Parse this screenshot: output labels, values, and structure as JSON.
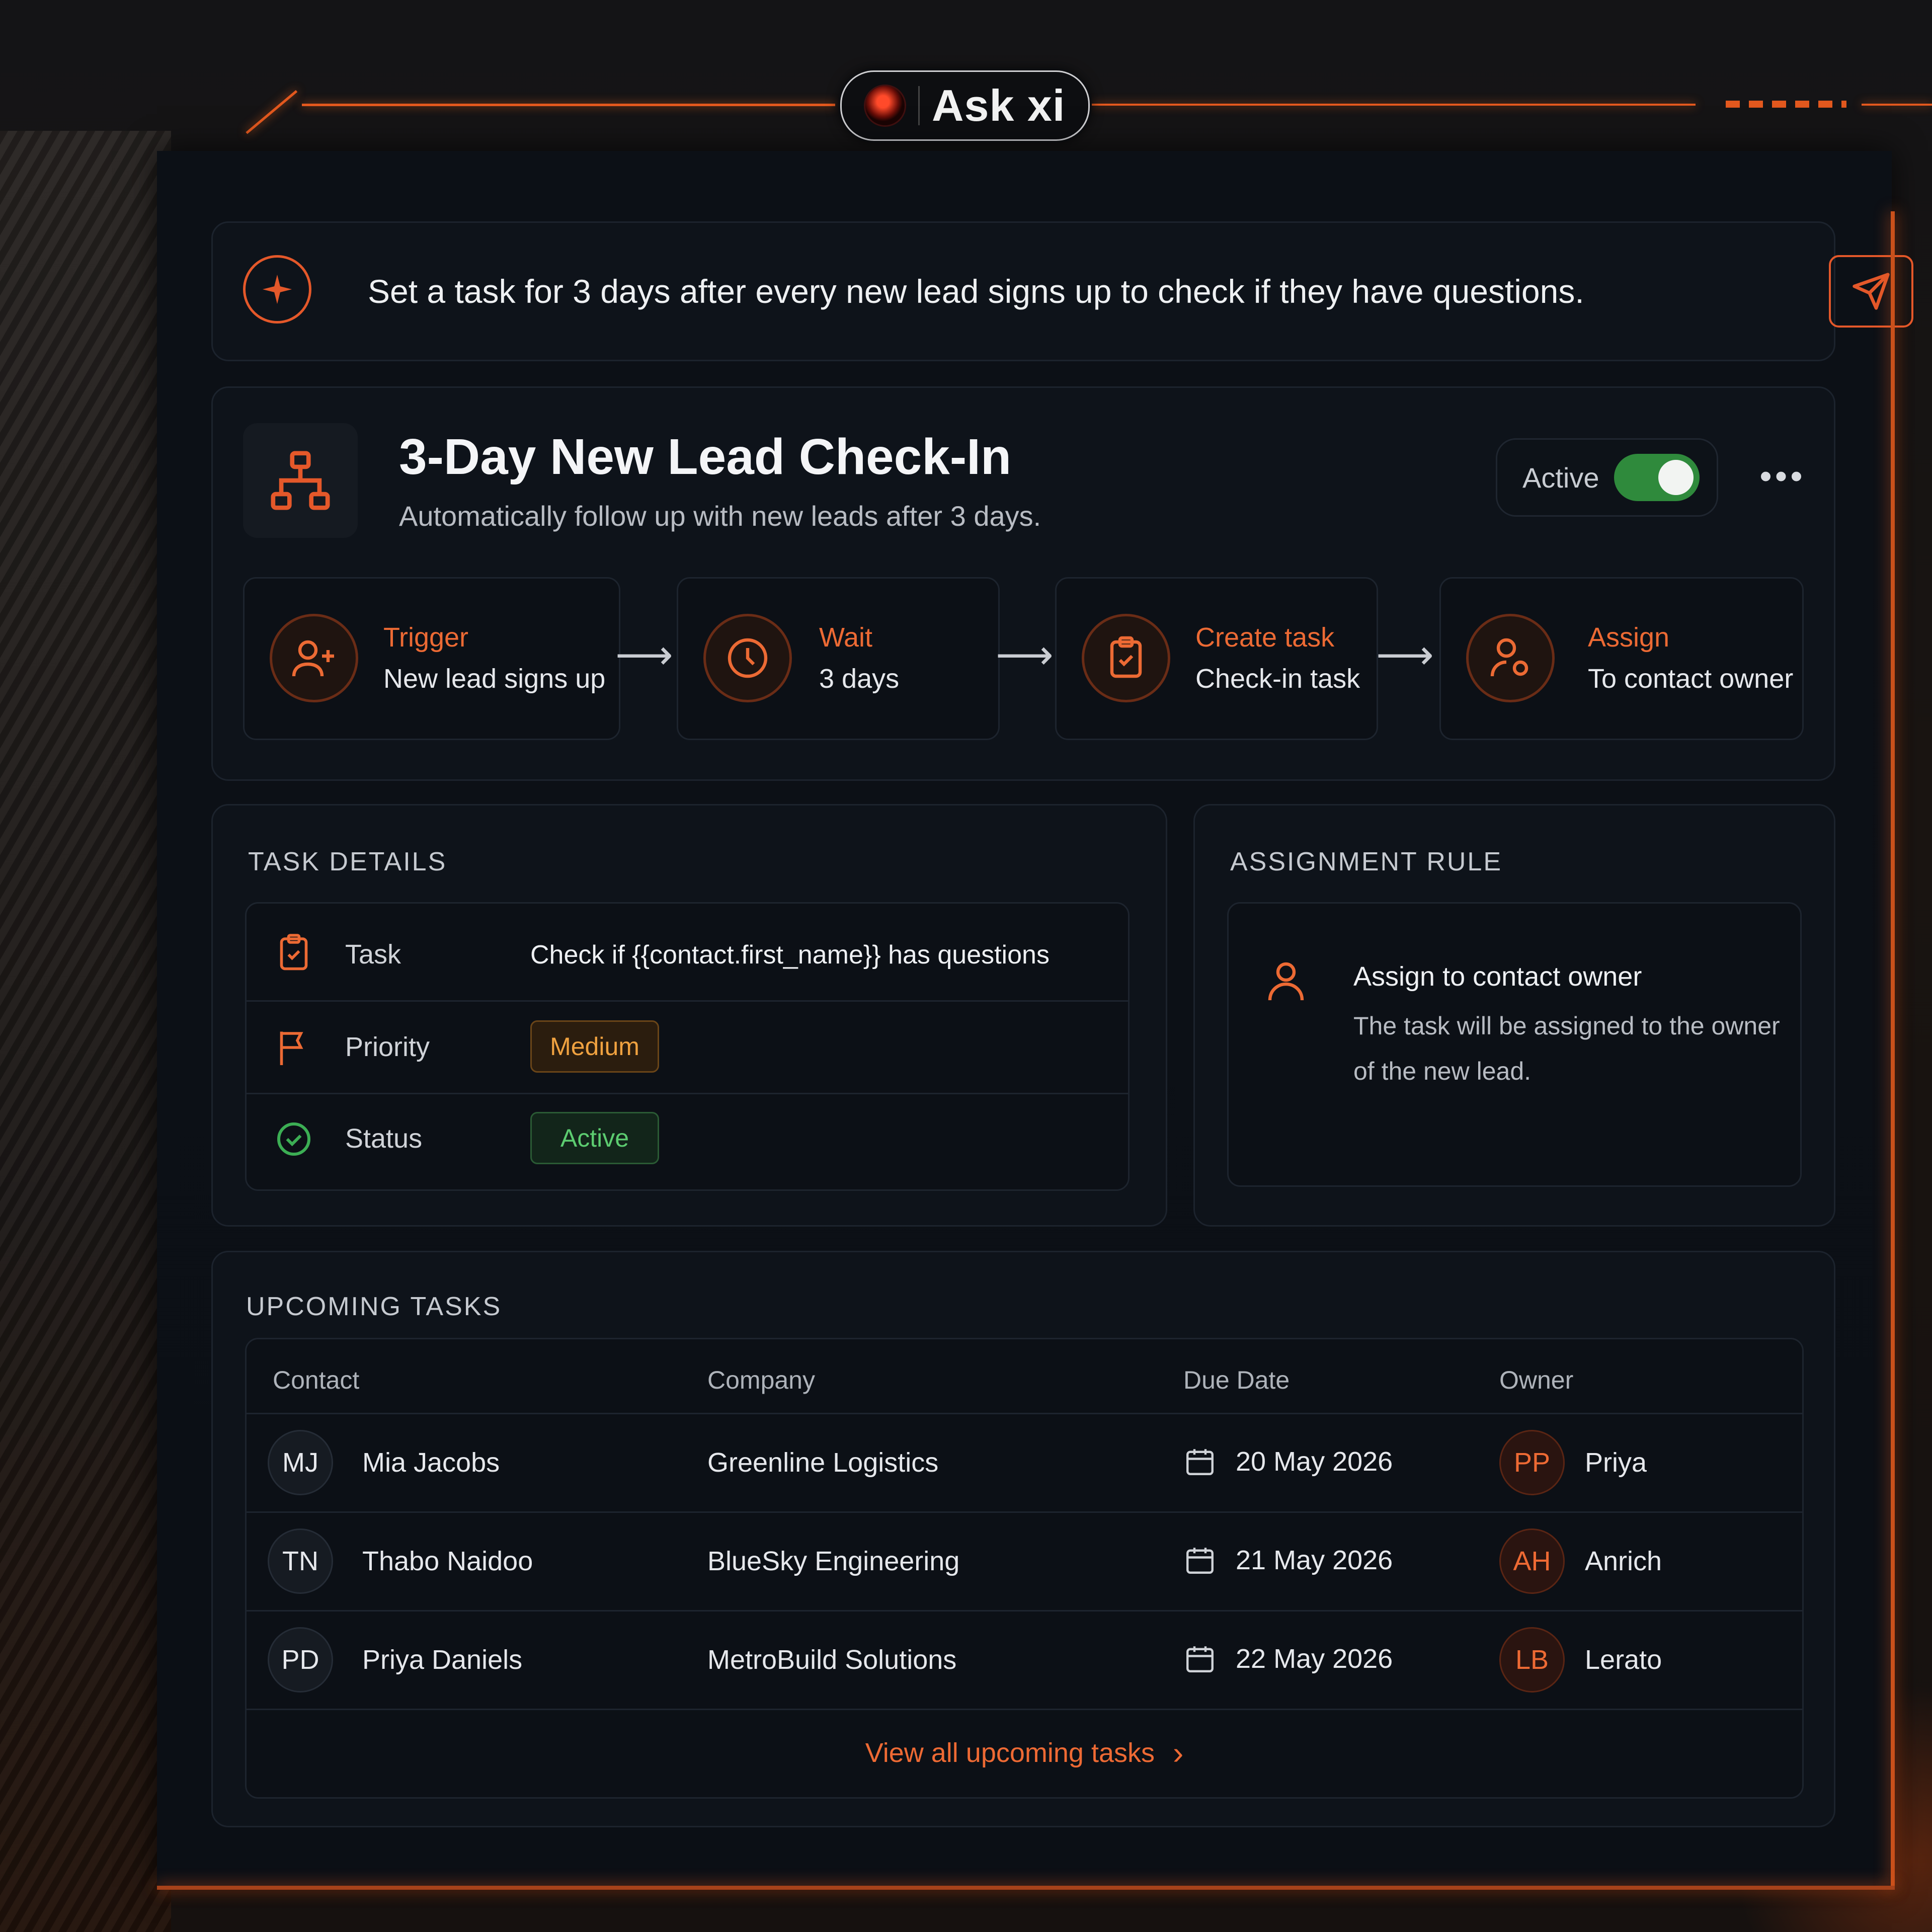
{
  "app": {
    "brand": "Ask xi",
    "accent": "#e4582a"
  },
  "prompt": {
    "text": "Set a task for 3 days after every new lead signs up to check if they have questions."
  },
  "workflow": {
    "title": "3-Day New Lead Check-In",
    "subtitle": "Automatically follow up with new leads after 3 days.",
    "status_label": "Active",
    "toggle_on": true,
    "more_label": "•••",
    "steps": [
      {
        "title": "Trigger",
        "value": "New lead signs up",
        "icon": "user-plus-icon"
      },
      {
        "title": "Wait",
        "value": "3 days",
        "icon": "clock-icon"
      },
      {
        "title": "Create task",
        "value": "Check-in task",
        "icon": "clipboard-check-icon"
      },
      {
        "title": "Assign",
        "value": "To contact owner",
        "icon": "user-assign-icon"
      }
    ],
    "arrow": "⟶"
  },
  "task_details": {
    "heading": "TASK DETAILS",
    "task_label": "Task",
    "task_value": "Check if {{contact.first_name}} has questions",
    "priority_label": "Priority",
    "priority_value": "Medium",
    "status_label": "Status",
    "status_value": "Active"
  },
  "assignment_rule": {
    "heading": "ASSIGNMENT RULE",
    "title": "Assign to contact owner",
    "line1": "The task will be assigned to the owner",
    "line2": "of the new lead."
  },
  "upcoming": {
    "heading": "UPCOMING TASKS",
    "columns": [
      "Contact",
      "Company",
      "Due Date",
      "Owner"
    ],
    "rows": [
      {
        "initials": "MJ",
        "contact": "Mia Jacobs",
        "company": "Greenline Logistics",
        "due": "20 May 2026",
        "owner_initials": "PP",
        "owner": "Priya"
      },
      {
        "initials": "TN",
        "contact": "Thabo Naidoo",
        "company": "BlueSky Engineering",
        "due": "21 May 2026",
        "owner_initials": "AH",
        "owner": "Anrich"
      },
      {
        "initials": "PD",
        "contact": "Priya Daniels",
        "company": "MetroBuild Solutions",
        "due": "22 May 2026",
        "owner_initials": "LB",
        "owner": "Lerato"
      }
    ],
    "view_all": "View all upcoming tasks",
    "view_all_chevron": "›"
  }
}
